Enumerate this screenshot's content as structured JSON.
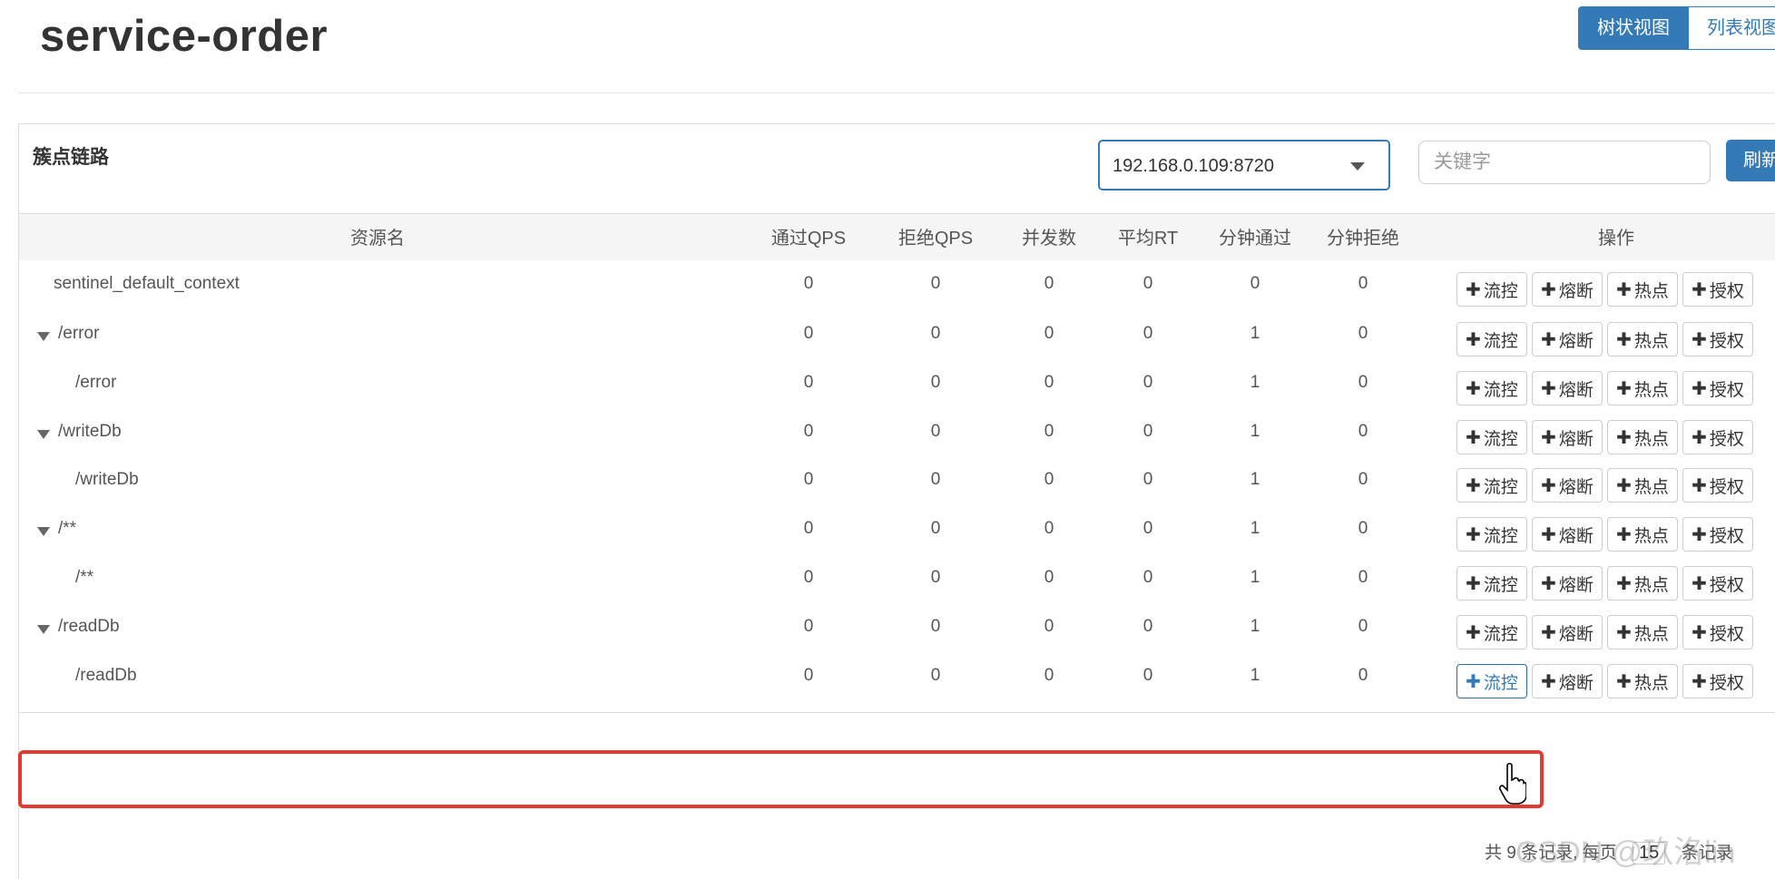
{
  "header": {
    "title": "service-order",
    "view_tabs": [
      "树状视图",
      "列表视图"
    ]
  },
  "panel": {
    "title": "簇点链路",
    "machine_select": {
      "selected": "192.168.0.109:8720"
    },
    "search": {
      "placeholder": "关键字",
      "value": ""
    },
    "refresh_label": "刷新"
  },
  "table": {
    "headers": {
      "name": "资源名",
      "pass_qps": "通过QPS",
      "block_qps": "拒绝QPS",
      "concurrency": "并发数",
      "avg_rt": "平均RT",
      "minute_pass": "分钟通过",
      "minute_block": "分钟拒绝",
      "ops": "操作"
    },
    "op_labels": [
      "流控",
      "熔断",
      "热点",
      "授权"
    ],
    "rows": [
      {
        "name": "sentinel_default_context",
        "pass_qps": "0",
        "block_qps": "0",
        "concurrency": "0",
        "avg_rt": "0",
        "minute_pass": "0",
        "minute_block": "0"
      },
      {
        "name": "/error",
        "pass_qps": "0",
        "block_qps": "0",
        "concurrency": "0",
        "avg_rt": "0",
        "minute_pass": "1",
        "minute_block": "0"
      },
      {
        "name": "/error",
        "pass_qps": "0",
        "block_qps": "0",
        "concurrency": "0",
        "avg_rt": "0",
        "minute_pass": "1",
        "minute_block": "0"
      },
      {
        "name": "/writeDb",
        "pass_qps": "0",
        "block_qps": "0",
        "concurrency": "0",
        "avg_rt": "0",
        "minute_pass": "1",
        "minute_block": "0"
      },
      {
        "name": "/writeDb",
        "pass_qps": "0",
        "block_qps": "0",
        "concurrency": "0",
        "avg_rt": "0",
        "minute_pass": "1",
        "minute_block": "0"
      },
      {
        "name": "/**",
        "pass_qps": "0",
        "block_qps": "0",
        "concurrency": "0",
        "avg_rt": "0",
        "minute_pass": "1",
        "minute_block": "0"
      },
      {
        "name": "/**",
        "pass_qps": "0",
        "block_qps": "0",
        "concurrency": "0",
        "avg_rt": "0",
        "minute_pass": "1",
        "minute_block": "0"
      },
      {
        "name": "/readDb",
        "pass_qps": "0",
        "block_qps": "0",
        "concurrency": "0",
        "avg_rt": "0",
        "minute_pass": "1",
        "minute_block": "0"
      },
      {
        "name": "/readDb",
        "pass_qps": "0",
        "block_qps": "0",
        "concurrency": "0",
        "avg_rt": "0",
        "minute_pass": "1",
        "minute_block": "0"
      }
    ]
  },
  "footer": {
    "total_text": "共 9 条记录, 每页",
    "page_size": "15",
    "suffix": "条记录"
  },
  "watermark": "CSDN @玖洛lin",
  "colors": {
    "primary": "#337ab7",
    "highlight": "#e53935"
  }
}
